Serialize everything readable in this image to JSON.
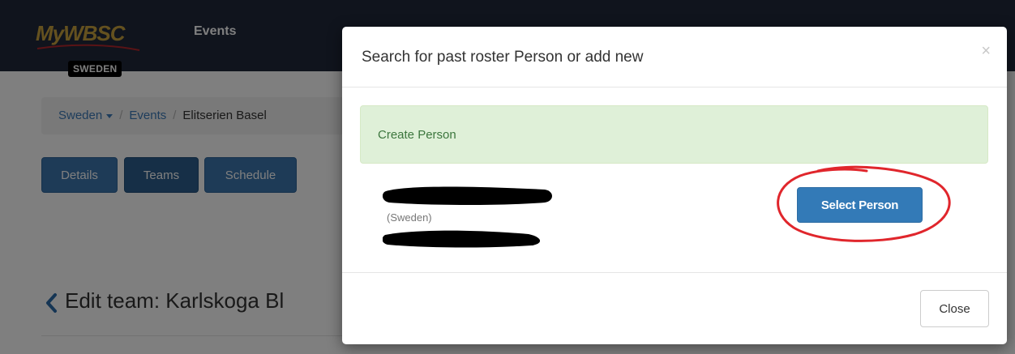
{
  "navbar": {
    "logo_text": "MyWBSC",
    "logo_badge": "SWEDEN",
    "events_link": "Events"
  },
  "breadcrumb": {
    "country": "Sweden",
    "events": "Events",
    "current": "Elitserien Basel",
    "separator": "/"
  },
  "tabs": [
    {
      "label": "Details"
    },
    {
      "label": "Teams"
    },
    {
      "label": "Schedule"
    }
  ],
  "page_title": "Edit team: Karlskoga Bl",
  "modal": {
    "title": "Search for past roster Person or add new",
    "close_icon": "×",
    "create_person": "Create Person",
    "person": {
      "country": "(Sweden)"
    },
    "select_button": "Select Person",
    "close_button": "Close"
  },
  "colors": {
    "navbar": "#20283a",
    "primary": "#337ab7",
    "success_bg": "#dff0d8",
    "success_text": "#3c763d",
    "annotation": "#e0262c"
  },
  "icons": [
    "chevron-down-icon",
    "chevron-left-icon",
    "close-icon"
  ]
}
